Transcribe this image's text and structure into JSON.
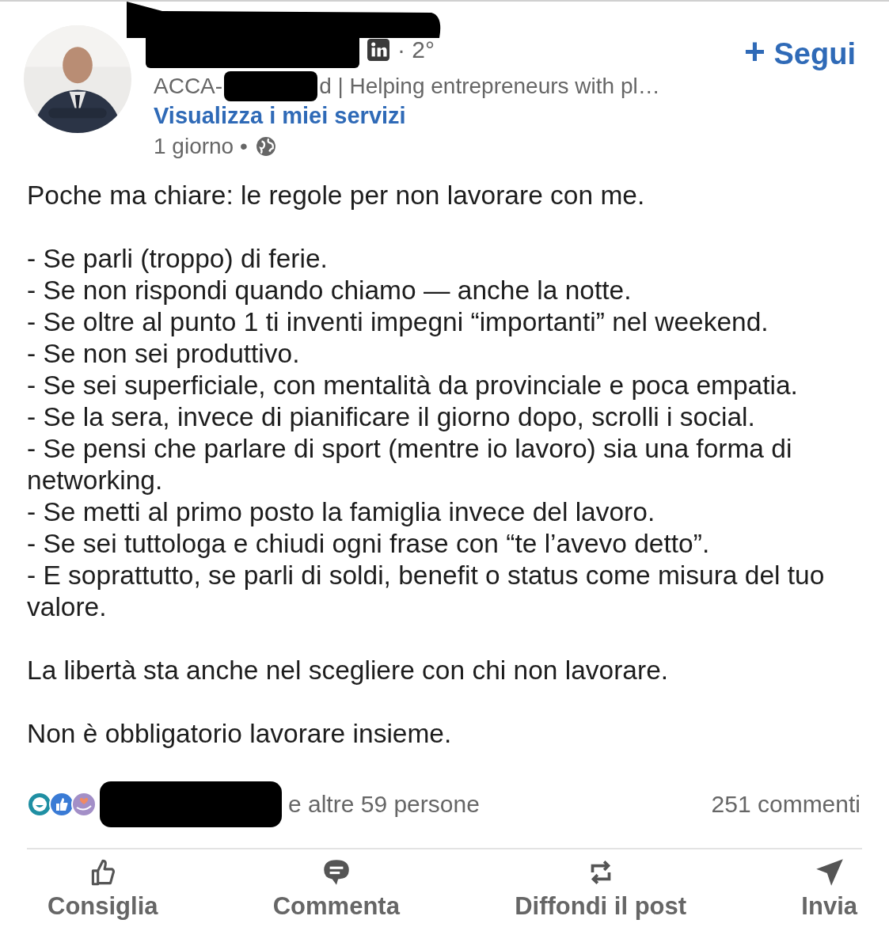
{
  "author": {
    "degree": "· 2°",
    "headline_start": "ACCA-",
    "headline_end": "d | Helping entrepreneurs with pl…",
    "services_link": "Visualizza i miei servizi",
    "time": "1 giorno •",
    "follow": {
      "icon": "+",
      "label": "Segui"
    }
  },
  "post": {
    "intro": "Poche ma chiare: le regole per non lavorare con me.",
    "rules": [
      "- Se parli (troppo) di ferie.",
      "- Se non rispondi quando chiamo — anche la notte.",
      "- Se oltre al punto 1 ti inventi impegni “importanti” nel weekend.",
      "- Se non sei produttivo.",
      "- Se sei superficiale, con mentalità da provinciale e poca empatia.",
      "- Se la sera, invece di pianificare il giorno dopo, scrolli i social.",
      "- Se pensi che parlare di sport (mentre io lavoro) sia una forma di networking.",
      "- Se metti al primo posto la famiglia invece del lavoro.",
      "- Se sei tuttologa e chiudi ogni frase con “te l’avevo detto”.",
      "- E soprattutto, se parli di soldi, benefit o status come misura del tuo valore."
    ],
    "closing": [
      "La libertà sta anche nel scegliere con chi non lavorare.",
      "Non è obbligatorio lavorare insieme."
    ]
  },
  "reactions": {
    "icons": [
      {
        "kind": "funny",
        "color": "#1f8fa3"
      },
      {
        "kind": "like",
        "color": "#3a7bd5"
      },
      {
        "kind": "support",
        "color": "#a38fc7"
      }
    ],
    "rest": "e altre 59 persone",
    "comments": "251 commenti"
  },
  "actions": [
    {
      "kind": "like",
      "label": "Consiglia"
    },
    {
      "kind": "comment",
      "label": "Commenta"
    },
    {
      "kind": "repost",
      "label": "Diffondi il post"
    },
    {
      "kind": "send",
      "label": "Invia"
    }
  ]
}
